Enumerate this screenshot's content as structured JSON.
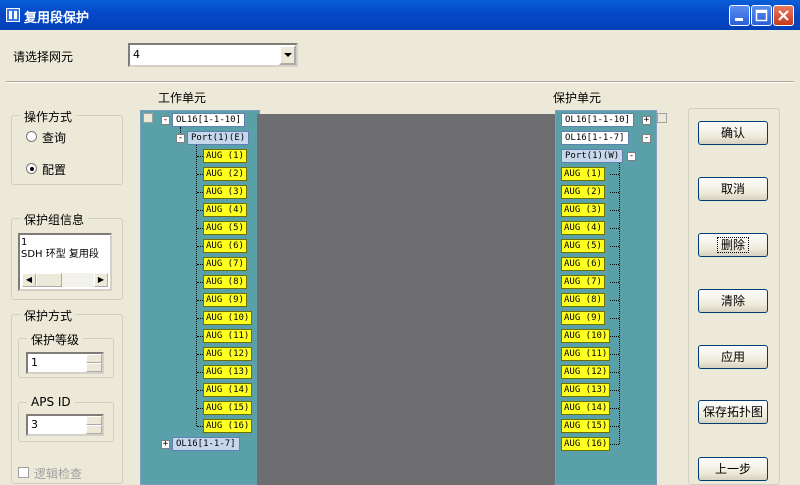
{
  "window": {
    "title": "复用段保护"
  },
  "ne_select": {
    "label": "请选择网元",
    "value": "4"
  },
  "headers": {
    "working": "工作单元",
    "protection": "保护单元"
  },
  "operation": {
    "title": "操作方式",
    "options": [
      "查询",
      "配置"
    ],
    "selected": "配置"
  },
  "group_info": {
    "title": "保护组信息",
    "lines": [
      "1",
      "SDH 环型 复用段"
    ]
  },
  "protect_mode": {
    "title": "保护方式",
    "level_title": "保护等级",
    "level_value": "1",
    "aps_title": "APS ID",
    "aps_value": "3"
  },
  "logic_check": {
    "label": "逻辑检查"
  },
  "working_tree": {
    "board": "OL16[1-1-10]",
    "port": "Port(1)(E)",
    "augs": [
      "AUG (1)",
      "AUG (2)",
      "AUG (3)",
      "AUG (4)",
      "AUG (5)",
      "AUG (6)",
      "AUG (7)",
      "AUG (8)",
      "AUG (9)",
      "AUG (10)",
      "AUG (11)",
      "AUG (12)",
      "AUG (13)",
      "AUG (14)",
      "AUG (15)",
      "AUG (16)"
    ],
    "board2": "OL16[1-1-7]"
  },
  "protection_tree": {
    "board": "OL16[1-1-10]",
    "board2": "OL16[1-1-7]",
    "port": "Port(1)(W)",
    "augs": [
      "AUG (1)",
      "AUG (2)",
      "AUG (3)",
      "AUG (4)",
      "AUG (5)",
      "AUG (6)",
      "AUG (7)",
      "AUG (8)",
      "AUG (9)",
      "AUG (10)",
      "AUG (11)",
      "AUG (12)",
      "AUG (13)",
      "AUG (14)",
      "AUG (15)",
      "AUG (16)"
    ]
  },
  "buttons": {
    "confirm": "确认",
    "cancel": "取消",
    "delete": "删除",
    "clear": "清除",
    "apply": "应用",
    "save_topo": "保存拓扑图",
    "prev": "上一步"
  },
  "icons": {
    "app": "app-icon",
    "minimize": "minimize-icon",
    "maximize": "maximize-icon",
    "close": "close-icon"
  },
  "colors": {
    "titlebar": "#0449c9",
    "tree_bg": "#5aa0a8",
    "aug": "#ffff20",
    "mid_panel": "#6e6d70"
  }
}
